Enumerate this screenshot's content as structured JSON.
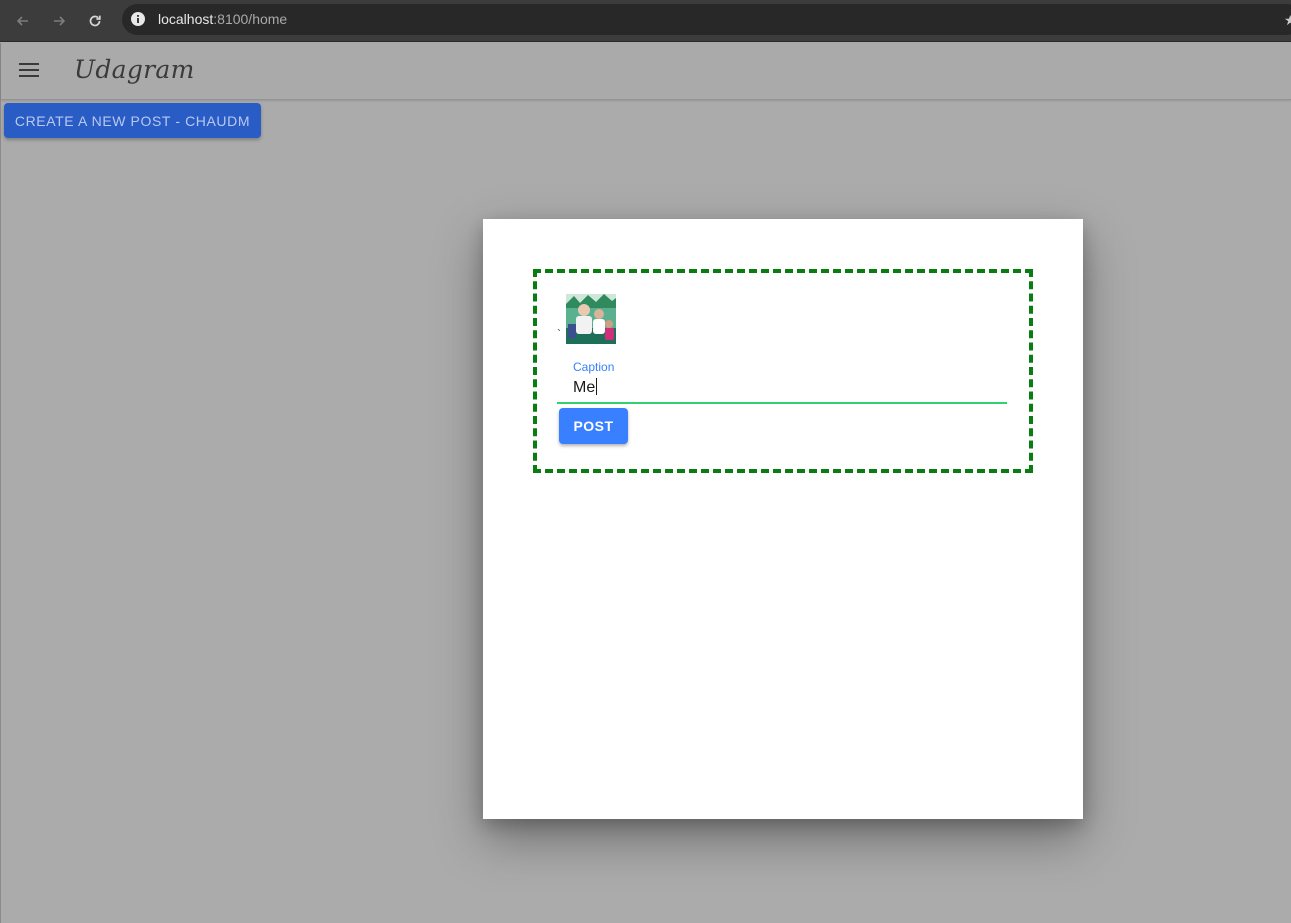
{
  "browser": {
    "back_icon": "arrow-left-icon",
    "forward_icon": "arrow-right-icon",
    "reload_icon": "reload-icon",
    "url_host": "localhost",
    "url_rest": ":8100/home"
  },
  "toolbar": {
    "menu_icon": "menu-icon",
    "title": "Udagram"
  },
  "main": {
    "create_button_label": "CREATE A NEW POST - CHAUDM"
  },
  "modal": {
    "tick": "`",
    "caption_label": "Caption",
    "caption_value": "Me",
    "post_button_label": "POST"
  },
  "colors": {
    "primary": "#3880ff",
    "success_underline": "#2dd36f",
    "dashed_border": "#0a7d12",
    "backdrop": "#ababab"
  }
}
